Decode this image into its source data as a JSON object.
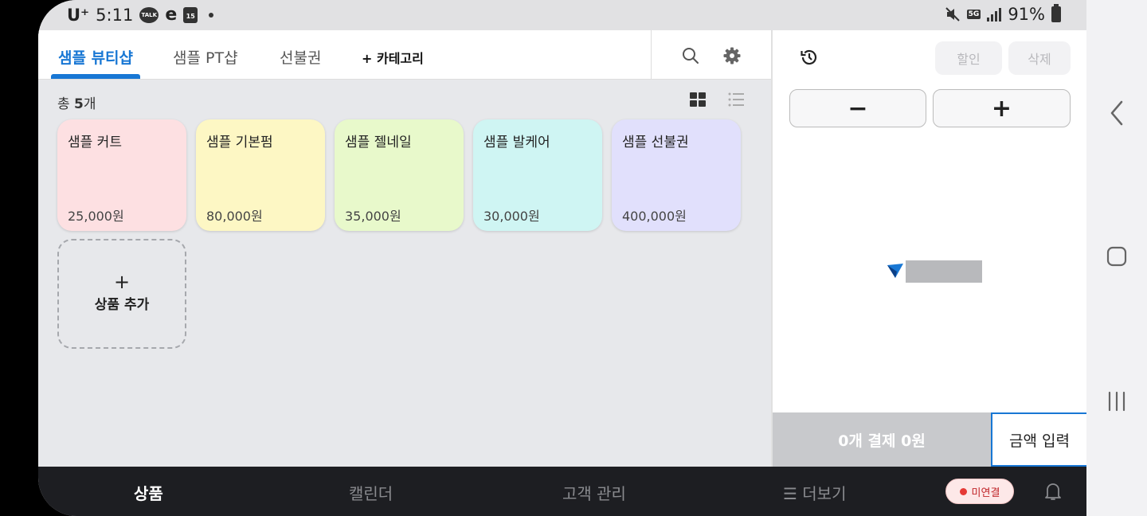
{
  "status_bar": {
    "carrier": "U⁺",
    "time": "5:11",
    "talk_icon_text": "TALK",
    "calendar_day": "15",
    "network": "5G",
    "battery": "91%"
  },
  "tabs": [
    {
      "label": "샘플 뷰티샵",
      "active": true
    },
    {
      "label": "샘플 PT샵",
      "active": false
    },
    {
      "label": "선불권",
      "active": false
    }
  ],
  "add_category_label": "+ 카테고리",
  "product_count": {
    "prefix": "총 ",
    "count": "5",
    "suffix": "개"
  },
  "products": [
    {
      "name": "샘플 커트",
      "price": "25,000원",
      "color": "#fde0e2"
    },
    {
      "name": "샘플 기본펌",
      "price": "80,000원",
      "color": "#fdf7c4"
    },
    {
      "name": "샘플 젤네일",
      "price": "35,000원",
      "color": "#e8f9cb"
    },
    {
      "name": "샘플 발케어",
      "price": "30,000원",
      "color": "#cff5f3"
    },
    {
      "name": "샘플 선불권",
      "price": "400,000원",
      "color": "#e1e0fc"
    }
  ],
  "add_product": {
    "plus": "+",
    "label": "상품 추가"
  },
  "right_pane": {
    "discount_label": "할인",
    "delete_label": "삭제",
    "minus_label": "−",
    "plus_label": "+",
    "pay_label": "0개 결제 0원",
    "amount_input_label": "금액 입력"
  },
  "bottom_nav": {
    "items": [
      "상품",
      "캘린더",
      "고객 관리",
      "☰ 더보기"
    ],
    "disconnect_label": "미연결"
  },
  "colors": {
    "accent": "#1877d4",
    "nav_bg": "#1d1e22",
    "badge_red": "#e53935"
  },
  "icons": [
    "search-icon",
    "settings-gear-icon",
    "grid-view-icon",
    "list-view-icon",
    "history-icon",
    "bell-icon",
    "back-icon",
    "home-icon",
    "recents-icon"
  ]
}
